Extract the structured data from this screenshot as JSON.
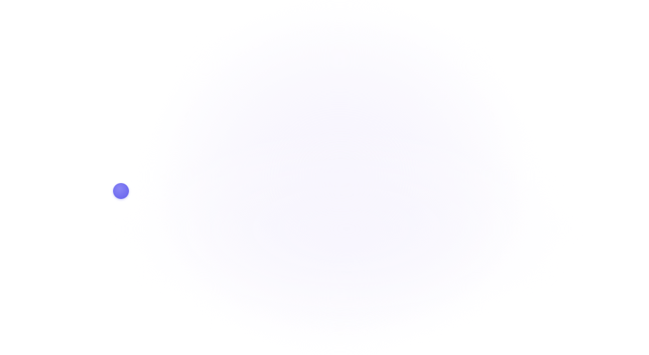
{
  "screen": {
    "background": "#ffffff",
    "glow_color": "#f6f3fd"
  },
  "indicator": {
    "icon": "dot-indicator-icon",
    "color": "#736ff0"
  }
}
